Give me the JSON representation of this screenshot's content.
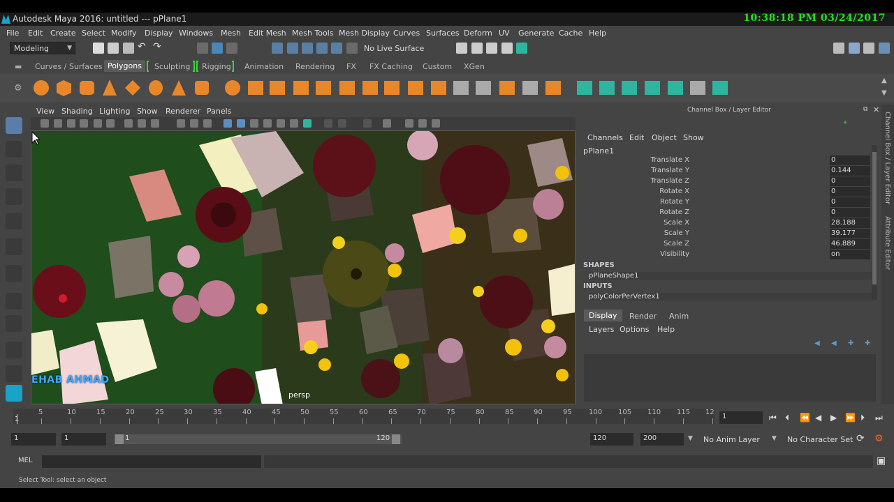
{
  "window": {
    "title": "Autodesk Maya 2016: untitled   ---   pPlane1",
    "clock": "10:38:18 PM 03/24/2017"
  },
  "menubar": [
    "File",
    "Edit",
    "Create",
    "Select",
    "Modify",
    "Display",
    "Windows",
    "Mesh",
    "Edit Mesh",
    "Mesh Tools",
    "Mesh Display",
    "Curves",
    "Surfaces",
    "Deform",
    "UV",
    "Generate",
    "Cache",
    "Help"
  ],
  "statusline": {
    "mode": "Modeling",
    "live_surface": "No Live Surface"
  },
  "shelf_tabs": [
    "Curves / Surfaces",
    "Polygons",
    "Sculpting",
    "Rigging",
    "Animation",
    "Rendering",
    "FX",
    "FX Caching",
    "Custom",
    "XGen"
  ],
  "shelf_active": "Polygons",
  "panel_menu": [
    "View",
    "Shading",
    "Lighting",
    "Show",
    "Renderer",
    "Panels"
  ],
  "viewport": {
    "camera": "persp",
    "watermark": "EHAB AHMAD"
  },
  "channel_box": {
    "title": "Channel Box / Layer Editor",
    "menus": [
      "Channels",
      "Edit",
      "Object",
      "Show"
    ],
    "object": "pPlane1",
    "attributes": [
      {
        "label": "Translate X",
        "value": "0"
      },
      {
        "label": "Translate Y",
        "value": "0.144"
      },
      {
        "label": "Translate Z",
        "value": "0"
      },
      {
        "label": "Rotate X",
        "value": "0"
      },
      {
        "label": "Rotate Y",
        "value": "0"
      },
      {
        "label": "Rotate Z",
        "value": "0"
      },
      {
        "label": "Scale X",
        "value": "28.188"
      },
      {
        "label": "Scale Y",
        "value": "39.177"
      },
      {
        "label": "Scale Z",
        "value": "46.889"
      },
      {
        "label": "Visibility",
        "value": "on"
      }
    ],
    "shapes_header": "SHAPES",
    "shape": "pPlaneShape1",
    "inputs_header": "INPUTS",
    "input": "polyColorPerVertex1"
  },
  "layer_editor": {
    "tabs": [
      "Display",
      "Render",
      "Anim"
    ],
    "active_tab": "Display",
    "menus": [
      "Layers",
      "Options",
      "Help"
    ]
  },
  "side_tabs": [
    "Channel Box / Layer Editor",
    "Attribute Editor"
  ],
  "time_slider": {
    "ticks": [
      "5",
      "10",
      "15",
      "20",
      "25",
      "30",
      "35",
      "40",
      "45",
      "50",
      "55",
      "60",
      "65",
      "70",
      "75",
      "80",
      "85",
      "90",
      "95",
      "100",
      "105",
      "110",
      "115",
      "12"
    ],
    "start_label": "1",
    "current_frame": "1"
  },
  "range_slider": {
    "start": "1",
    "playback_start": "1",
    "range_start_label": "1",
    "range_end_label": "120",
    "playback_end": "120",
    "end": "200",
    "anim_layer": "No Anim Layer",
    "character_set": "No Character Set"
  },
  "command_line": {
    "language": "MEL"
  },
  "help_line": "Select Tool: select an object"
}
